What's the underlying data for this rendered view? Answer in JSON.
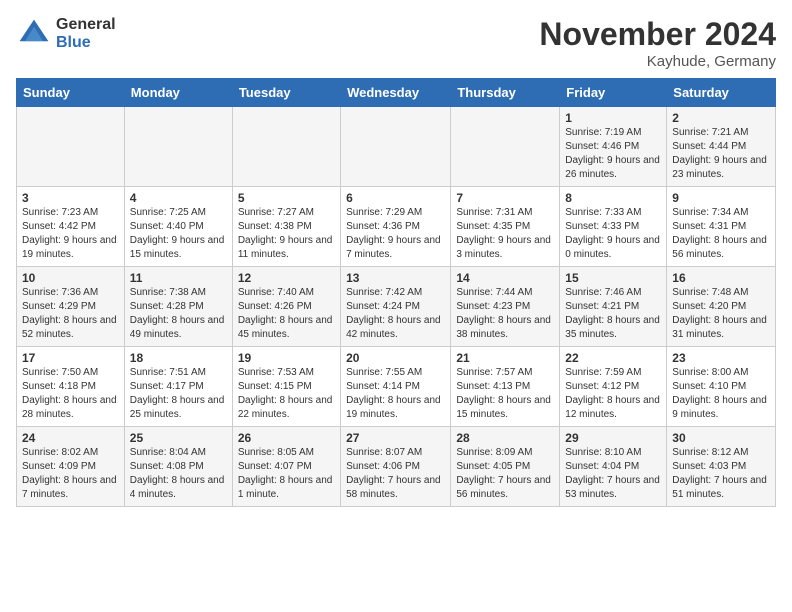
{
  "header": {
    "logo_general": "General",
    "logo_blue": "Blue",
    "month_title": "November 2024",
    "location": "Kayhude, Germany"
  },
  "weekdays": [
    "Sunday",
    "Monday",
    "Tuesday",
    "Wednesday",
    "Thursday",
    "Friday",
    "Saturday"
  ],
  "weeks": [
    [
      {
        "day": "",
        "info": ""
      },
      {
        "day": "",
        "info": ""
      },
      {
        "day": "",
        "info": ""
      },
      {
        "day": "",
        "info": ""
      },
      {
        "day": "",
        "info": ""
      },
      {
        "day": "1",
        "info": "Sunrise: 7:19 AM\nSunset: 4:46 PM\nDaylight: 9 hours and 26 minutes."
      },
      {
        "day": "2",
        "info": "Sunrise: 7:21 AM\nSunset: 4:44 PM\nDaylight: 9 hours and 23 minutes."
      }
    ],
    [
      {
        "day": "3",
        "info": "Sunrise: 7:23 AM\nSunset: 4:42 PM\nDaylight: 9 hours and 19 minutes."
      },
      {
        "day": "4",
        "info": "Sunrise: 7:25 AM\nSunset: 4:40 PM\nDaylight: 9 hours and 15 minutes."
      },
      {
        "day": "5",
        "info": "Sunrise: 7:27 AM\nSunset: 4:38 PM\nDaylight: 9 hours and 11 minutes."
      },
      {
        "day": "6",
        "info": "Sunrise: 7:29 AM\nSunset: 4:36 PM\nDaylight: 9 hours and 7 minutes."
      },
      {
        "day": "7",
        "info": "Sunrise: 7:31 AM\nSunset: 4:35 PM\nDaylight: 9 hours and 3 minutes."
      },
      {
        "day": "8",
        "info": "Sunrise: 7:33 AM\nSunset: 4:33 PM\nDaylight: 9 hours and 0 minutes."
      },
      {
        "day": "9",
        "info": "Sunrise: 7:34 AM\nSunset: 4:31 PM\nDaylight: 8 hours and 56 minutes."
      }
    ],
    [
      {
        "day": "10",
        "info": "Sunrise: 7:36 AM\nSunset: 4:29 PM\nDaylight: 8 hours and 52 minutes."
      },
      {
        "day": "11",
        "info": "Sunrise: 7:38 AM\nSunset: 4:28 PM\nDaylight: 8 hours and 49 minutes."
      },
      {
        "day": "12",
        "info": "Sunrise: 7:40 AM\nSunset: 4:26 PM\nDaylight: 8 hours and 45 minutes."
      },
      {
        "day": "13",
        "info": "Sunrise: 7:42 AM\nSunset: 4:24 PM\nDaylight: 8 hours and 42 minutes."
      },
      {
        "day": "14",
        "info": "Sunrise: 7:44 AM\nSunset: 4:23 PM\nDaylight: 8 hours and 38 minutes."
      },
      {
        "day": "15",
        "info": "Sunrise: 7:46 AM\nSunset: 4:21 PM\nDaylight: 8 hours and 35 minutes."
      },
      {
        "day": "16",
        "info": "Sunrise: 7:48 AM\nSunset: 4:20 PM\nDaylight: 8 hours and 31 minutes."
      }
    ],
    [
      {
        "day": "17",
        "info": "Sunrise: 7:50 AM\nSunset: 4:18 PM\nDaylight: 8 hours and 28 minutes."
      },
      {
        "day": "18",
        "info": "Sunrise: 7:51 AM\nSunset: 4:17 PM\nDaylight: 8 hours and 25 minutes."
      },
      {
        "day": "19",
        "info": "Sunrise: 7:53 AM\nSunset: 4:15 PM\nDaylight: 8 hours and 22 minutes."
      },
      {
        "day": "20",
        "info": "Sunrise: 7:55 AM\nSunset: 4:14 PM\nDaylight: 8 hours and 19 minutes."
      },
      {
        "day": "21",
        "info": "Sunrise: 7:57 AM\nSunset: 4:13 PM\nDaylight: 8 hours and 15 minutes."
      },
      {
        "day": "22",
        "info": "Sunrise: 7:59 AM\nSunset: 4:12 PM\nDaylight: 8 hours and 12 minutes."
      },
      {
        "day": "23",
        "info": "Sunrise: 8:00 AM\nSunset: 4:10 PM\nDaylight: 8 hours and 9 minutes."
      }
    ],
    [
      {
        "day": "24",
        "info": "Sunrise: 8:02 AM\nSunset: 4:09 PM\nDaylight: 8 hours and 7 minutes."
      },
      {
        "day": "25",
        "info": "Sunrise: 8:04 AM\nSunset: 4:08 PM\nDaylight: 8 hours and 4 minutes."
      },
      {
        "day": "26",
        "info": "Sunrise: 8:05 AM\nSunset: 4:07 PM\nDaylight: 8 hours and 1 minute."
      },
      {
        "day": "27",
        "info": "Sunrise: 8:07 AM\nSunset: 4:06 PM\nDaylight: 7 hours and 58 minutes."
      },
      {
        "day": "28",
        "info": "Sunrise: 8:09 AM\nSunset: 4:05 PM\nDaylight: 7 hours and 56 minutes."
      },
      {
        "day": "29",
        "info": "Sunrise: 8:10 AM\nSunset: 4:04 PM\nDaylight: 7 hours and 53 minutes."
      },
      {
        "day": "30",
        "info": "Sunrise: 8:12 AM\nSunset: 4:03 PM\nDaylight: 7 hours and 51 minutes."
      }
    ]
  ]
}
